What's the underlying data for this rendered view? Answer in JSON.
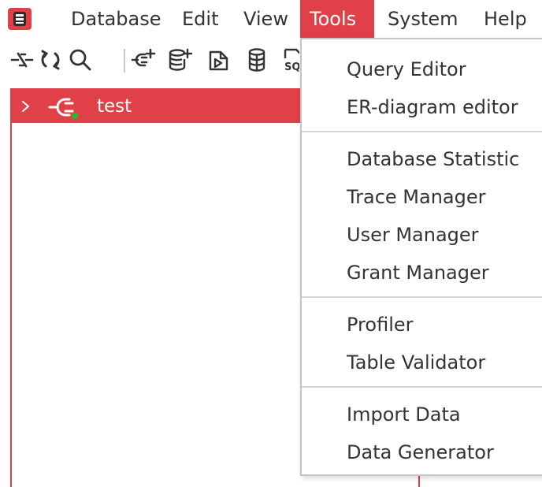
{
  "menubar": {
    "items": [
      {
        "label": "Database"
      },
      {
        "label": "Edit"
      },
      {
        "label": "View"
      },
      {
        "label": "Tools",
        "active": true
      },
      {
        "label": "System"
      },
      {
        "label": "Help"
      }
    ]
  },
  "toolbar": {
    "icons": [
      "disconnect-icon",
      "refresh-icon",
      "search-icon",
      "new-connection-icon",
      "add-database-icon",
      "open-script-icon",
      "database-icon",
      "sql-script-icon"
    ]
  },
  "navigator": {
    "tree": [
      {
        "label": "test",
        "icon": "connection-icon",
        "status": "connected",
        "expanded": false,
        "selected": true
      }
    ]
  },
  "tools_menu": {
    "groups": [
      [
        {
          "label": "Query Editor"
        },
        {
          "label": "ER-diagram editor"
        }
      ],
      [
        {
          "label": "Database Statistic"
        },
        {
          "label": "Trace Manager"
        },
        {
          "label": "User Manager"
        },
        {
          "label": "Grant Manager"
        }
      ],
      [
        {
          "label": "Profiler"
        },
        {
          "label": "Table Validator"
        }
      ],
      [
        {
          "label": "Import Data"
        },
        {
          "label": "Data Generator"
        }
      ]
    ]
  },
  "colors": {
    "accent": "#e04048",
    "status_connected": "#22bb33",
    "menu_border": "#c4c4c4"
  }
}
